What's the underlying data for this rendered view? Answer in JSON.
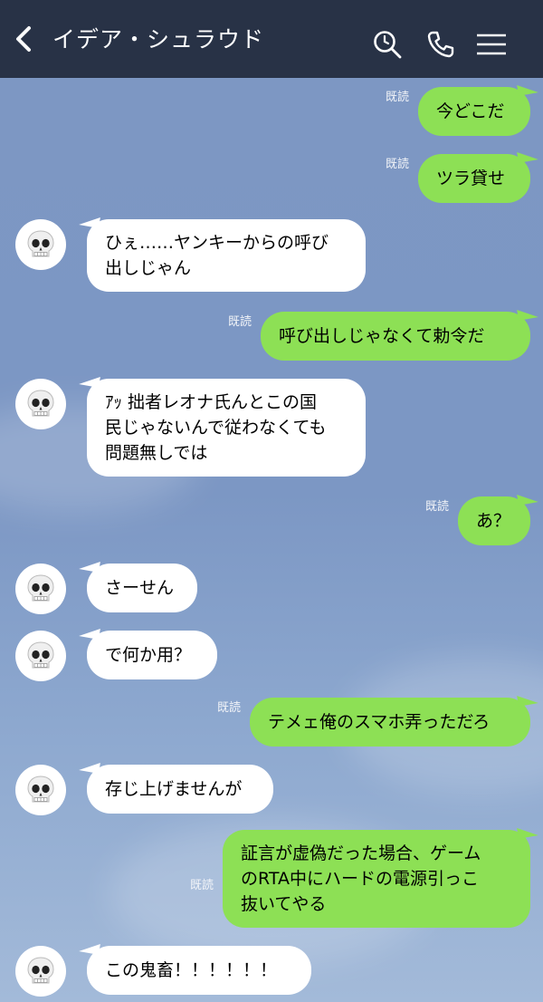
{
  "header": {
    "title": "イデア・シュラウド",
    "back_icon": "chevron-left-icon",
    "search_icon": "search-icon",
    "call_icon": "phone-icon",
    "menu_icon": "menu-icon"
  },
  "read_label": "既読",
  "messages": [
    {
      "side": "out",
      "read": true,
      "lines": [
        "今どこだ"
      ]
    },
    {
      "side": "out",
      "read": true,
      "lines": [
        "ツラ貸せ"
      ]
    },
    {
      "side": "in",
      "lines": [
        "ひぇ……ヤンキーからの呼び",
        "出しじゃん"
      ]
    },
    {
      "side": "out",
      "read": true,
      "lines": [
        "呼び出しじゃなくて勅令だ"
      ]
    },
    {
      "side": "in",
      "lines": [
        "ｱｯ 拙者レオナ氏んとこの国",
        "民じゃないんで従わなくても",
        "問題無しでは"
      ]
    },
    {
      "side": "out",
      "read": true,
      "lines": [
        "あ？"
      ]
    },
    {
      "side": "in",
      "lines": [
        "さーせん"
      ]
    },
    {
      "side": "in",
      "lines": [
        "で何か用？"
      ]
    },
    {
      "side": "out",
      "read": true,
      "lines": [
        "テメェ俺のスマホ弄っただろ"
      ]
    },
    {
      "side": "in",
      "lines": [
        "存じ上げませんが"
      ]
    },
    {
      "side": "out",
      "read": true,
      "lines": [
        "証言が虚偽だった場合、ゲーム",
        "のRTA中にハードの電源引っこ",
        "抜いてやる"
      ]
    },
    {
      "side": "in",
      "lines": [
        "この鬼畜！！！！！！"
      ]
    }
  ],
  "colors": {
    "header_bg": "#283246",
    "chat_bg": "#7d97c3",
    "outgoing_bubble": "#8de055",
    "incoming_bubble": "#ffffff"
  }
}
